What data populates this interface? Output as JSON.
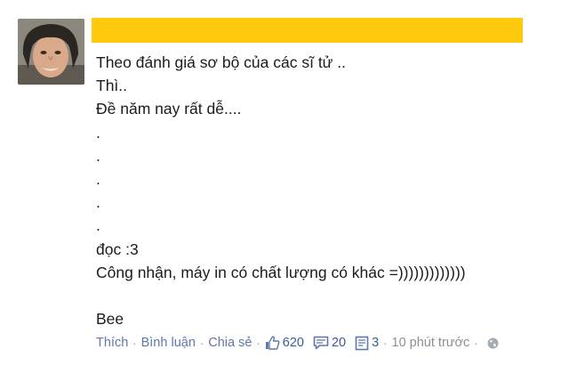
{
  "post": {
    "message_lines": [
      "Theo đánh giá sơ bộ của các sĩ tử ..",
      "Thì..",
      "Đề năm nay rất dễ....",
      ".",
      ".",
      ".",
      ".",
      ".",
      "đọc :3",
      "Công nhận, máy in có chất lượng có khác =)))))))))))))",
      "",
      "Bee"
    ]
  },
  "footer": {
    "like_label": "Thích",
    "comment_label": "Bình luận",
    "share_label": "Chia sẻ",
    "separator": "·",
    "likes_count": "620",
    "comments_count": "20",
    "shares_count": "3",
    "timestamp": "10 phút trước"
  },
  "icons": {
    "likes": "thumbs-up-icon",
    "comments": "comment-bubble-icon",
    "shares": "share-document-icon",
    "privacy": "globe-icon"
  },
  "colors": {
    "name_bar": "#ffc90e",
    "link": "#5f78ab",
    "text": "#1c1c1c"
  }
}
